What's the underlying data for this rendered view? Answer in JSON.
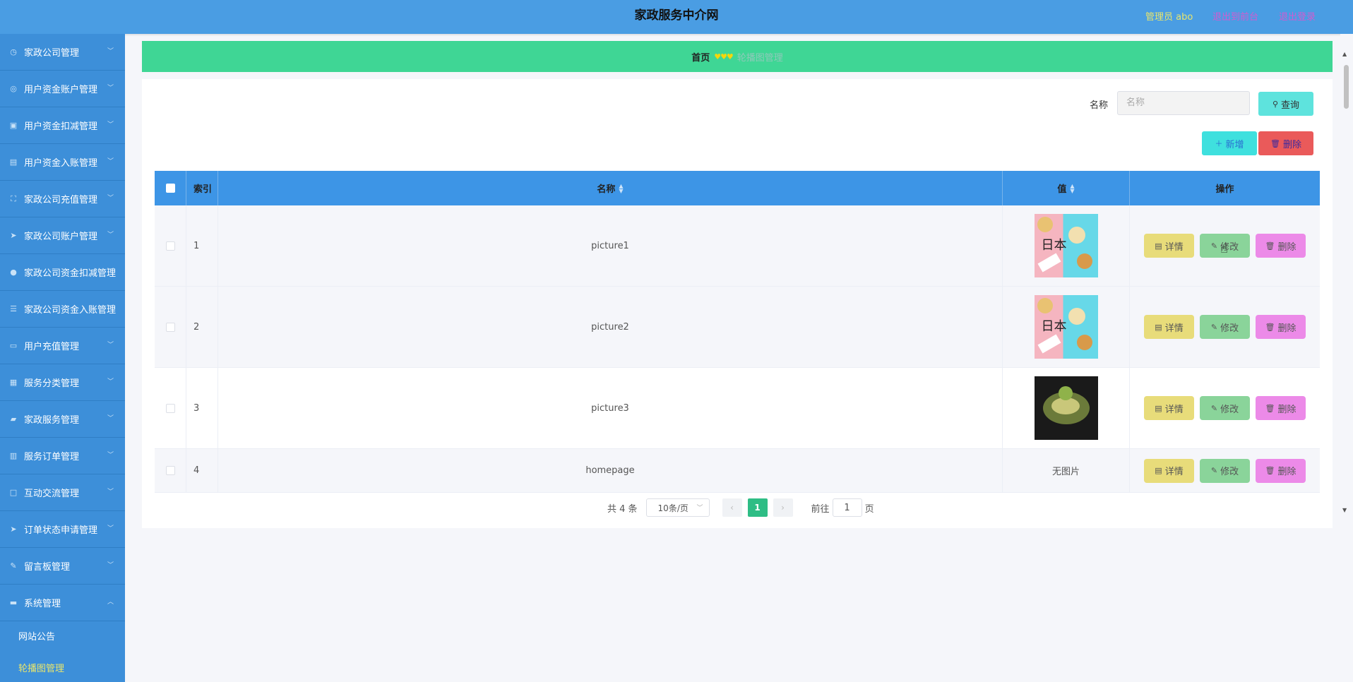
{
  "header": {
    "title": "家政服务中介网",
    "user_label": "管理员 abo",
    "back_link": "退出到前台",
    "logout_link": "退出登录",
    "user_color": "#e8e56c",
    "link_color": "#d05cd0"
  },
  "sidebar": {
    "items": [
      {
        "label": "家政公司管理",
        "icon": "clock-icon"
      },
      {
        "label": "用户资金账户管理",
        "icon": "compass-icon"
      },
      {
        "label": "用户资金扣减管理",
        "icon": "image-icon"
      },
      {
        "label": "用户资金入账管理",
        "icon": "clipboard-icon"
      },
      {
        "label": "家政公司充值管理",
        "icon": "expand-icon"
      },
      {
        "label": "家政公司账户管理",
        "icon": "send-icon"
      },
      {
        "label": "家政公司资金扣减管理",
        "icon": "user-icon"
      },
      {
        "label": "家政公司资金入账管理",
        "icon": "list-icon"
      },
      {
        "label": "用户充值管理",
        "icon": "message-icon"
      },
      {
        "label": "服务分类管理",
        "icon": "grid-icon"
      },
      {
        "label": "家政服务管理",
        "icon": "truck-icon"
      },
      {
        "label": "服务订单管理",
        "icon": "bar-chart-icon"
      },
      {
        "label": "互动交流管理",
        "icon": "square-icon"
      },
      {
        "label": "订单状态申请管理",
        "icon": "send-icon"
      },
      {
        "label": "留言板管理",
        "icon": "edit-icon"
      },
      {
        "label": "系统管理",
        "icon": "briefcase-icon"
      }
    ],
    "submenu": [
      {
        "label": "网站公告",
        "active": false
      },
      {
        "label": "轮播图管理",
        "active": true
      }
    ]
  },
  "breadcrumb": {
    "home": "首页",
    "separator": "♥♥♥",
    "current": "轮播图管理"
  },
  "search": {
    "label": "名称",
    "placeholder": "名称",
    "query_button": "查询"
  },
  "actions": {
    "add_button": "新增",
    "delete_button": "删除"
  },
  "table": {
    "headers": {
      "index": "索引",
      "name": "名称",
      "value": "值",
      "ops": "操作"
    },
    "rows": [
      {
        "index": "1",
        "name": "picture1",
        "value": "food-image",
        "no_image": ""
      },
      {
        "index": "2",
        "name": "picture2",
        "value": "food-image",
        "no_image": ""
      },
      {
        "index": "3",
        "name": "picture3",
        "value": "dark-food-image",
        "no_image": ""
      },
      {
        "index": "4",
        "name": "homepage",
        "value": "",
        "no_image": "无图片"
      }
    ],
    "row_buttons": {
      "detail": "详情",
      "edit": "修改",
      "delete": "删除"
    }
  },
  "pagination": {
    "total": "共 4 条",
    "page_size": "10条/页",
    "current_page": "1",
    "goto_label": "前往",
    "goto_value": "1",
    "page_suffix": "页"
  },
  "colors": {
    "header_bg": "#4a9de3",
    "sidebar_bg": "#3d8fd9",
    "breadcrumb_bg": "#3fd695",
    "table_header_bg": "#3d95e6"
  }
}
